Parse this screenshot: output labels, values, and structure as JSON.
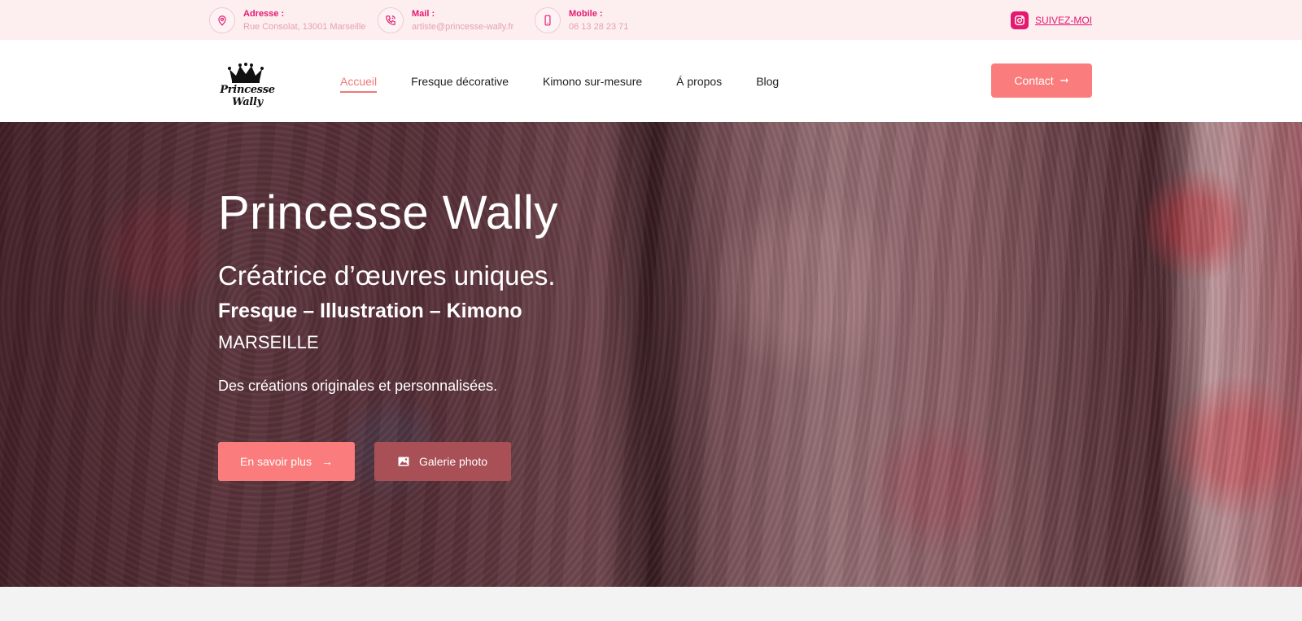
{
  "topbar": {
    "address": {
      "label": "Adresse :",
      "value": "Rue Consolat, 13001 Marseille",
      "icon": "map-pin-icon"
    },
    "mail": {
      "label": "Mail :",
      "value": "artiste@princesse-wally.fr",
      "icon": "phone-call-icon"
    },
    "mobile": {
      "label": "Mobile :",
      "value": "06 13 28 23 71",
      "icon": "smartphone-icon"
    },
    "follow_label": "SUIVEZ-MOI",
    "follow_icon": "instagram-icon"
  },
  "header": {
    "logo_text": "Princesse Wally",
    "nav": [
      {
        "label": "Accueil",
        "active": true
      },
      {
        "label": "Fresque décorative"
      },
      {
        "label": "Kimono sur-mesure"
      },
      {
        "label": "Á propos"
      },
      {
        "label": "Blog"
      }
    ],
    "contact_label": "Contact"
  },
  "hero": {
    "title": "Princesse Wally",
    "subtitle": "Créatrice d’œuvres uniques.",
    "tagline": "Fresque – Illustration – Kimono",
    "city": "MARSEILLE",
    "description": "Des créations originales et personnalisées.",
    "primary_button": "En savoir plus",
    "secondary_button": "Galerie photo"
  },
  "colors": {
    "accent": "#fb7c7c",
    "pink": "#e5196f",
    "topbar_bg": "#fdeef0",
    "secondary_button": "#a85056"
  }
}
